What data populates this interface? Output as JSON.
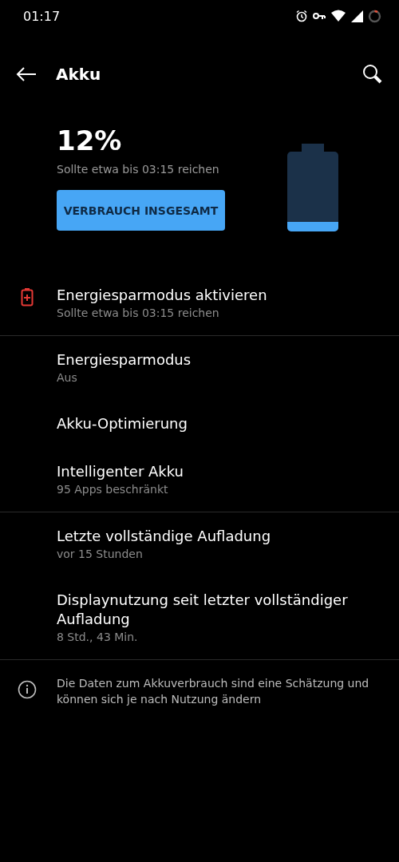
{
  "status_bar": {
    "time": "01:17"
  },
  "app_bar": {
    "title": "Akku"
  },
  "summary": {
    "percent": "12%",
    "estimate": "Sollte etwa bis 03:15 reichen",
    "button": "VERBRAUCH INSGESAMT"
  },
  "sections": [
    {
      "items": [
        {
          "title": "Energiesparmodus aktivieren",
          "subtitle": "Sollte etwa bis 03:15 reichen",
          "kind": "warning"
        }
      ]
    },
    {
      "items": [
        {
          "title": "Energiesparmodus",
          "subtitle": "Aus"
        },
        {
          "title": "Akku-Optimierung"
        },
        {
          "title": "Intelligenter Akku",
          "subtitle": "95 Apps beschränkt"
        }
      ]
    },
    {
      "items": [
        {
          "title": "Letzte vollständige Aufladung",
          "subtitle": "vor 15 Stunden"
        },
        {
          "title": "Displaynutzung seit letzter vollständiger Aufladung",
          "subtitle": "8 Std., 43 Min."
        }
      ]
    }
  ],
  "footer": {
    "text": "Die Daten zum Akkuverbrauch sind eine Schätzung und können sich je nach Nutzung ändern"
  }
}
